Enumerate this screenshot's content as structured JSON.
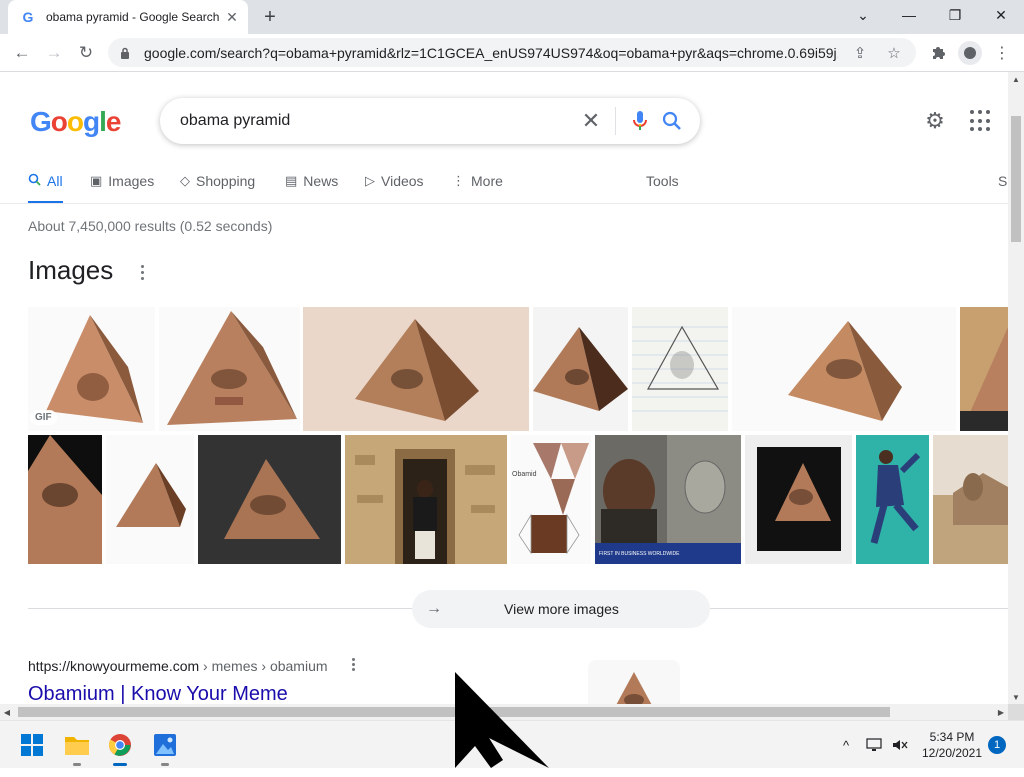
{
  "browser": {
    "tab_title": "obama pyramid - Google Search",
    "url": "google.com/search?q=obama+pyramid&rlz=1C1GCEA_enUS974US974&oq=obama+pyr&aqs=chrome.0.69i59j..."
  },
  "search": {
    "query": "obama pyramid",
    "logo": [
      "G",
      "o",
      "o",
      "g",
      "l",
      "e"
    ]
  },
  "tabs": {
    "all": "All",
    "images": "Images",
    "shopping": "Shopping",
    "news": "News",
    "videos": "Videos",
    "more": "More",
    "tools": "Tools",
    "safesearch_partial": "S"
  },
  "results": {
    "stats": "About 7,450,000 results (0.52 seconds)",
    "images_heading": "Images",
    "gif_badge": "GIF",
    "obamid_label": "Obamid",
    "news_caption": "FIRST IN BUSINESS WORLDWIDE",
    "view_more": "View more images",
    "first_result": {
      "url_domain": "https://knowyourmeme.com",
      "url_path": " › memes › obamium",
      "title": "Obamium | Know Your Meme"
    }
  },
  "taskbar": {
    "time": "5:34 PM",
    "date": "12/20/2021",
    "notifications": "1"
  },
  "colors": {
    "accent": "#1a73e8",
    "link": "#1a0dab",
    "win_accent": "#0067c0"
  }
}
